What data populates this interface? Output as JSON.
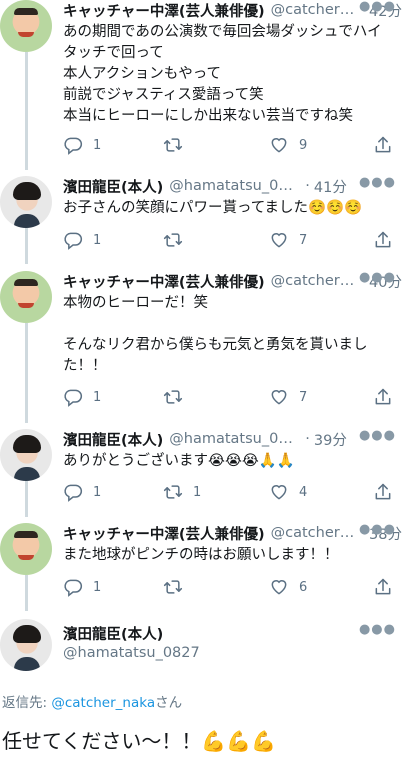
{
  "tweets": [
    {
      "name": "キャッチャー中澤(芸人兼俳優)",
      "handle": "@catcher_naka",
      "time": "42分",
      "text": "あの期間であの公演数で毎回会場ダッシュでハイタッチで回って\n本人アクションもやって\n前説でジャスティス愛語って笑\n本当にヒーローにしか出来ない芸当ですね笑",
      "replies": "1",
      "retweets": "",
      "likes": "9"
    },
    {
      "name": "濱田龍臣(本人)",
      "handle": "@hamatatsu_0827",
      "time": "41分",
      "text": "お子さんの笑顔にパワー貰ってました☺️☺️☺️",
      "replies": "1",
      "retweets": "",
      "likes": "7"
    },
    {
      "name": "キャッチャー中澤(芸人兼俳優)",
      "handle": "@catcher_naka",
      "time": "40分",
      "text": "本物のヒーローだ！笑\n\nそんなリク君から僕らも元気と勇気を貰いました！！",
      "replies": "1",
      "retweets": "",
      "likes": "7"
    },
    {
      "name": "濱田龍臣(本人)",
      "handle": "@hamatatsu_0827",
      "time": "39分",
      "text": "ありがとうございます😭😭😭🙏🙏",
      "replies": "1",
      "retweets": "1",
      "likes": "4"
    },
    {
      "name": "キャッチャー中澤(芸人兼俳優)",
      "handle": "@catcher_naka",
      "time": "38分",
      "text": "また地球がピンチの時はお願いします！！",
      "replies": "1",
      "retweets": "",
      "likes": "6"
    }
  ],
  "focused": {
    "name": "濱田龍臣(本人)",
    "handle": "@hamatatsu_0827",
    "replying_prefix": "返信先: ",
    "replying_to": "@catcher_naka",
    "replying_suffix": "さん",
    "text": "任せてください〜！！💪💪💪"
  },
  "ui": {
    "dot": "·",
    "more": "●●●"
  },
  "colors": {
    "text": "#14171a",
    "muted": "#657786",
    "link": "#1b95e0",
    "thread_line": "#cfd9de"
  },
  "icons": [
    "reply-icon",
    "retweet-icon",
    "like-icon",
    "share-icon",
    "more-icon"
  ]
}
